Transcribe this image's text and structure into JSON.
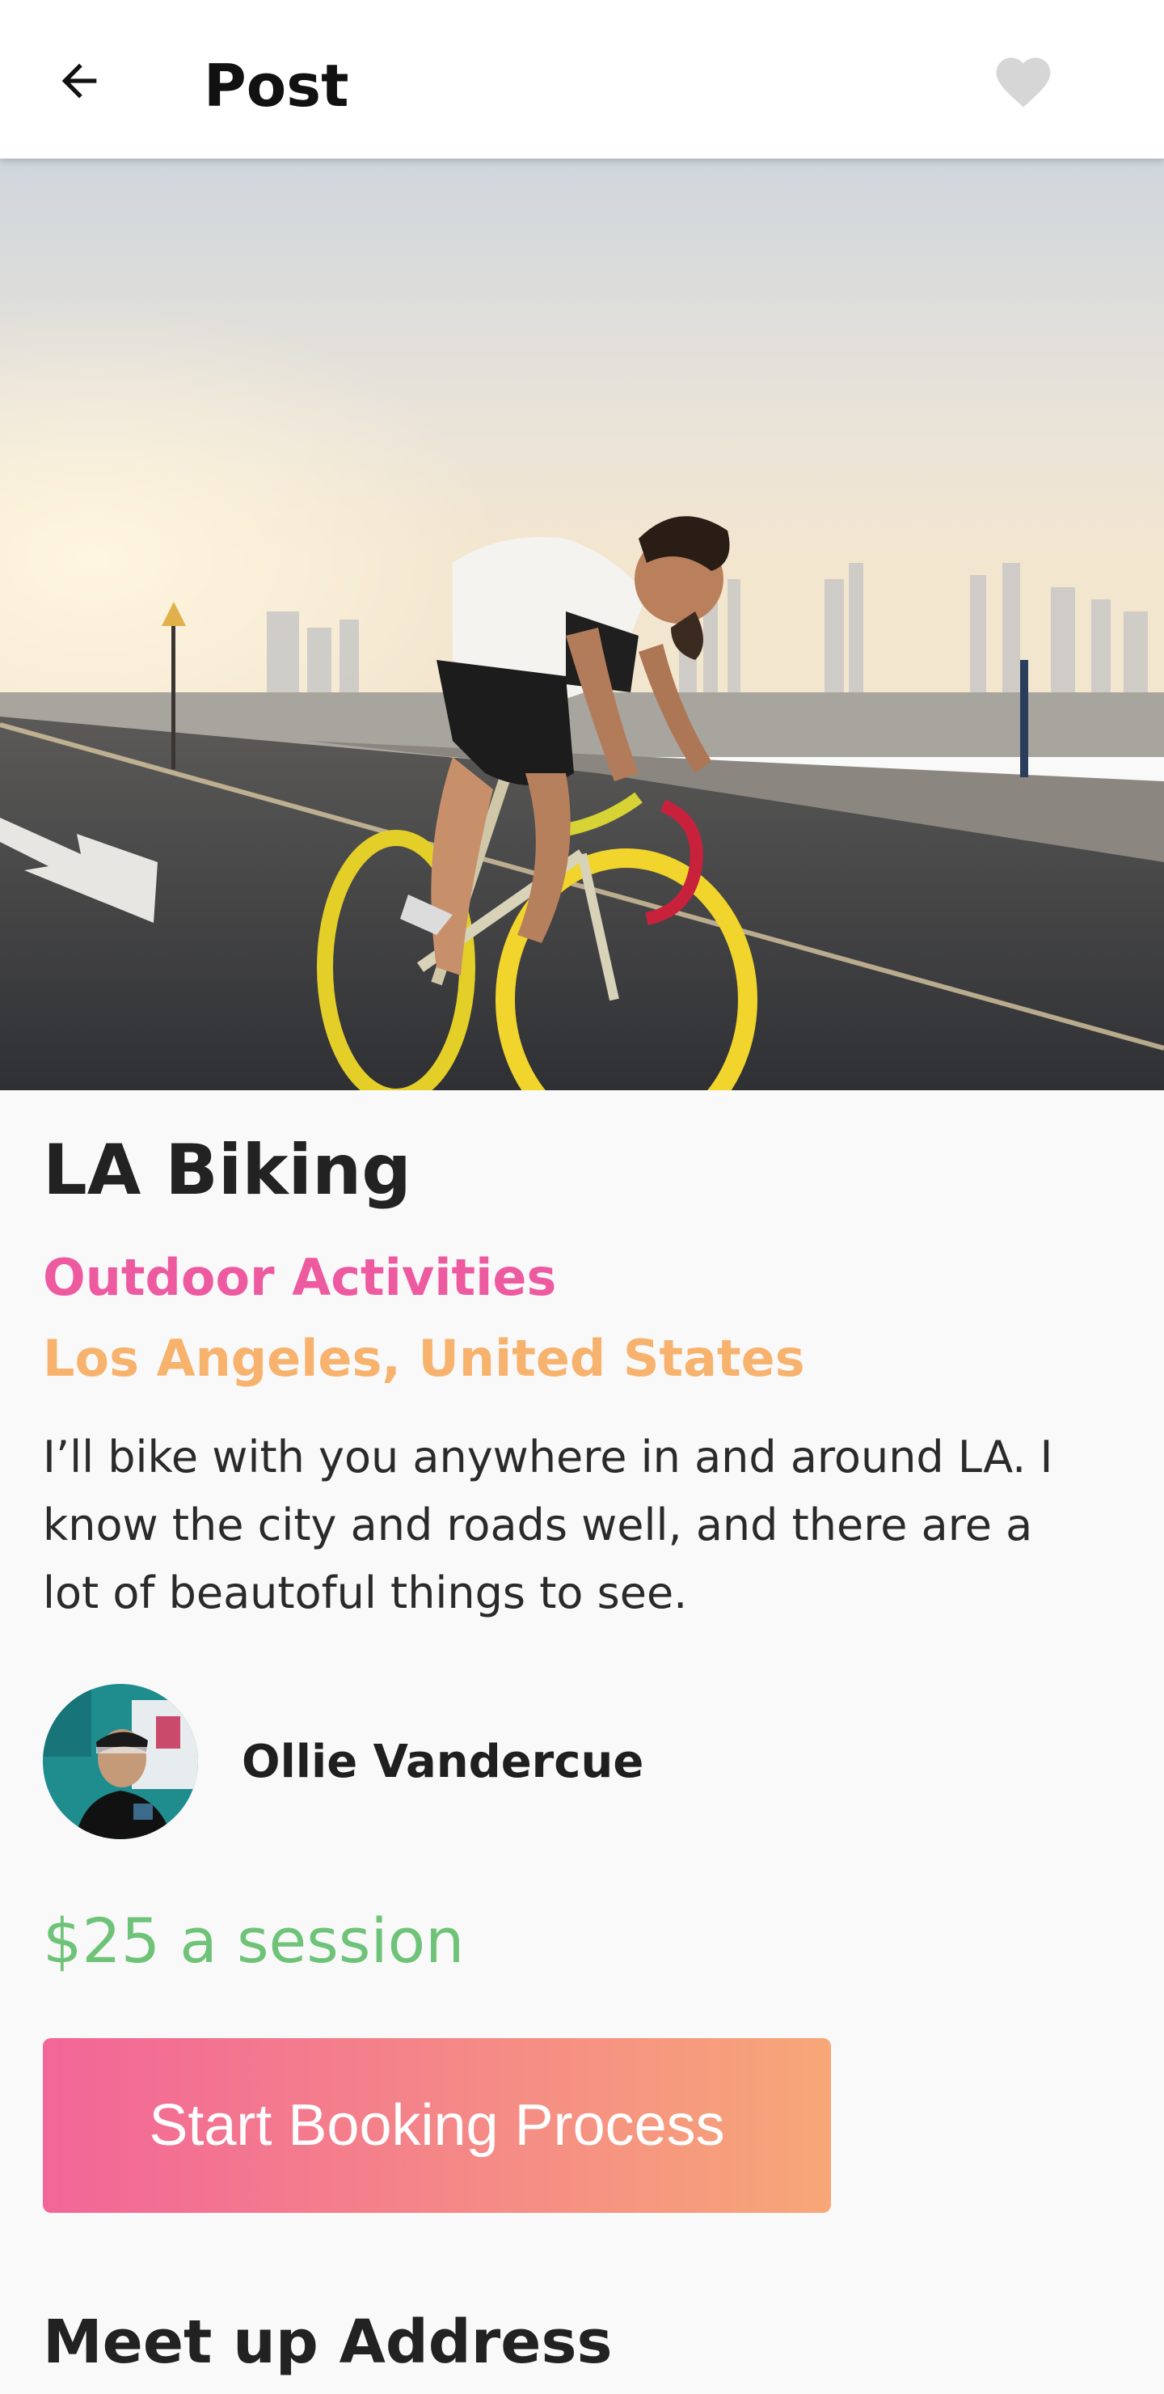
{
  "appbar": {
    "title": "Post",
    "back_icon": "arrow-left-icon",
    "favorite_icon": "heart-icon"
  },
  "hero": {
    "icon": "photo-cyclist"
  },
  "post": {
    "title": "LA Biking",
    "category": "Outdoor Activities",
    "location": "Los Angeles, United States",
    "description": "I’ll bike with you anywhere in and around LA. I know the city and roads well, and there are a lot of beautoful things to see."
  },
  "owner": {
    "name": "Ollie Vandercue"
  },
  "price": "$25 a session",
  "booking_button": "Start Booking Process",
  "meetup_section": {
    "title": "Meet up Address"
  },
  "colors": {
    "category": "#ee5aa0",
    "location": "#f7b26d",
    "price": "#6fc378",
    "button_start": "#f26598",
    "button_end": "#f7a778",
    "favorite_inactive": "#d6d6d6"
  }
}
